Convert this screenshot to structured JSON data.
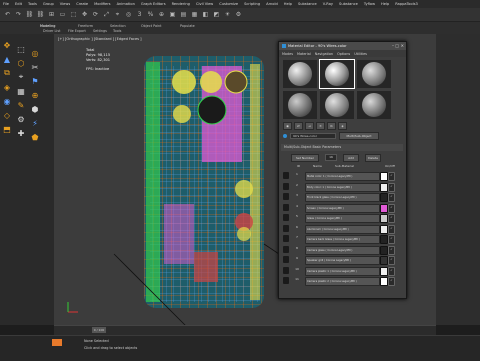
{
  "app": {
    "title": "Material Editor - 90's Wires-color"
  },
  "menubar": [
    "File",
    "Edit",
    "Tools",
    "Group",
    "Views",
    "Create",
    "Modifiers",
    "Animation",
    "Graph Editors",
    "Rendering",
    "Civil View",
    "Customize",
    "Scripting",
    "Arnold",
    "Help",
    "Substance",
    "V-Ray",
    "Substance",
    "Tyflow",
    "Help",
    "RappaTools3"
  ],
  "ribbon": {
    "tabs": [
      "Modeling",
      "Freeform",
      "Selection",
      "Object Paint",
      "Populate"
    ],
    "sub": [
      "Driver List",
      "File Export",
      "Settings",
      "Tools"
    ]
  },
  "viewport": {
    "label": "[+] [Orthographic ] [Standard ] [Edged Faces ]",
    "stats": {
      "total_label": "Total",
      "polys": "Polys: 98,115",
      "verts": "Verts: 82,301",
      "fps_label": "FPS:",
      "fps": "Inactive"
    }
  },
  "mated": {
    "menus": [
      "Modes",
      "Material",
      "Navigation",
      "Options",
      "Utilities"
    ],
    "mtl_name": "90's Wires-color",
    "type": "Multi/Sub-Object",
    "rollout": "Multi/Sub-Object Basic Parameters",
    "set_number": "Set Number",
    "add": "Add",
    "delete": "Delete",
    "count": "16",
    "headers": [
      "ID",
      "Name",
      "Sub-Material",
      "On/Off"
    ],
    "rows": [
      {
        "id": "1",
        "name": "Metal color: 1 ( Corona LegacyMtl )"
      },
      {
        "id": "2",
        "name": "Body color: 1 ( Corona LegacyMtl )"
      },
      {
        "id": "3",
        "name": "Front black glass ( Corona LegacyMtl )"
      },
      {
        "id": "4",
        "name": "Screen ( Corona LegacyMtl )"
      },
      {
        "id": "5",
        "name": "Glass ( Corona LegacyMtl )"
      },
      {
        "id": "6",
        "name": "Aluminium ( Corona LegacyMtl )"
      },
      {
        "id": "7",
        "name": "Camera back Glass ( Corona LegacyMtl )"
      },
      {
        "id": "8",
        "name": "Camera glass ( Corona LegacyMtl )"
      },
      {
        "id": "9",
        "name": "Speaker grill ( Corona LegacyMtl )"
      },
      {
        "id": "10",
        "name": "Camera plastic 1 ( Corona LegacyMtl )"
      },
      {
        "id": "11",
        "name": "Camera plastic 2 ( Corona LegacyMtl )"
      }
    ]
  },
  "timeline": {
    "frame": "0 / 100"
  },
  "status": {
    "selected": "None Selected",
    "hint": "Click and drag to select objects"
  },
  "colors": {
    "accent": "#2f8fd6",
    "wire": "#ff6a00",
    "pink": "#e25bd6",
    "yellow": "#e8e04a",
    "green": "#34d34a"
  }
}
